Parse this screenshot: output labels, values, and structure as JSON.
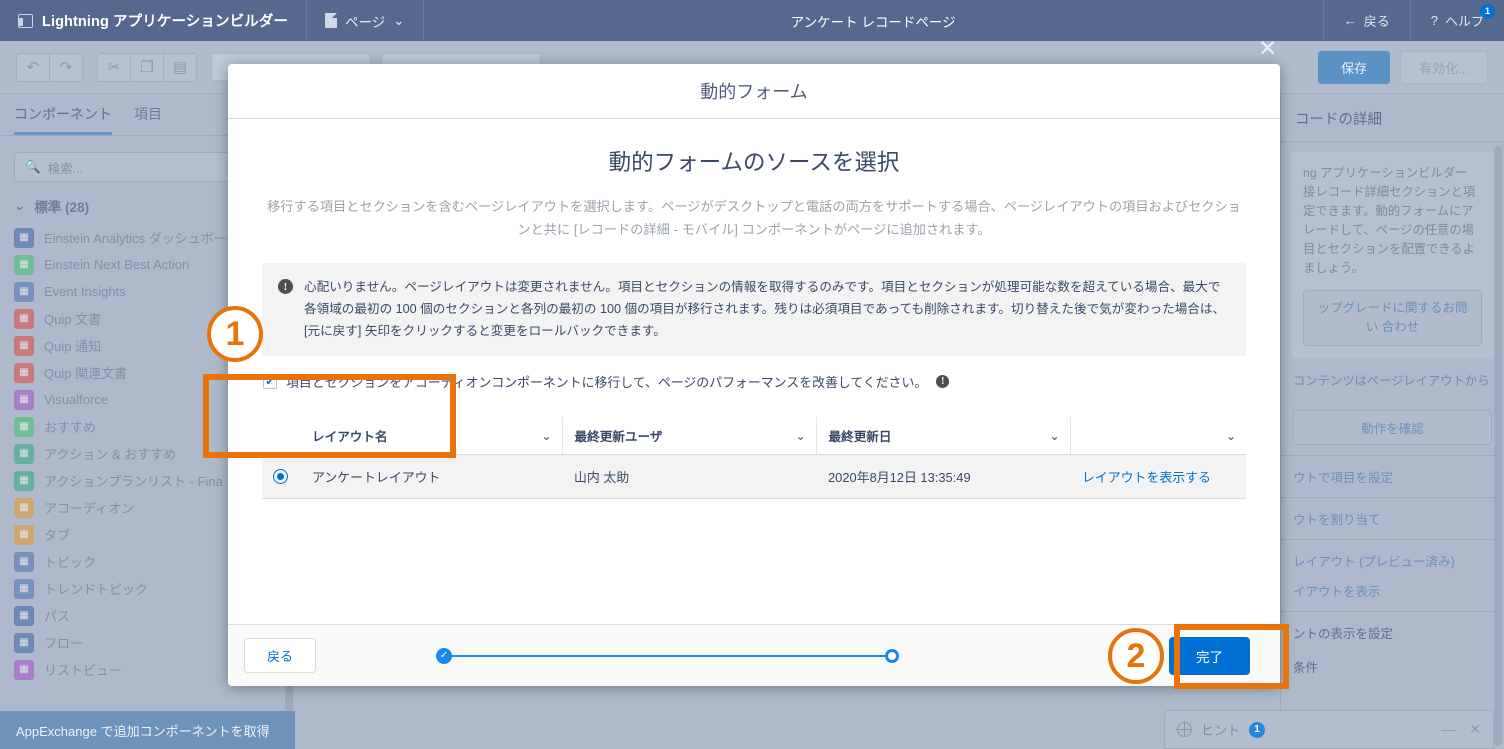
{
  "topbar": {
    "brand": "Lightning アプリケーションビルダー",
    "page_menu": "ページ",
    "title": "アンケート レコードページ",
    "back": "戻る",
    "help": "ヘルプ",
    "help_badge": "1"
  },
  "toolbar": {
    "undo_icon": "undo-icon",
    "redo_icon": "redo-icon",
    "cut_icon": "cut-icon",
    "copy_icon": "copy-icon",
    "paste_icon": "paste-icon",
    "save_label": "保存",
    "activate_label": "有効化..."
  },
  "left_panel": {
    "tabs": [
      {
        "label": "コンポーネント",
        "active": true
      },
      {
        "label": "項目",
        "active": false
      }
    ],
    "search_placeholder": "検索...",
    "section_label": "標準 (28)",
    "items": [
      {
        "label": "Einstein Analytics ダッシュボー",
        "color": "#4a6fa8"
      },
      {
        "label": "Einstein Next Best Action",
        "color": "#4bc076"
      },
      {
        "label": "Event Insights",
        "color": "#5a79b5"
      },
      {
        "label": "Quip 文書",
        "color": "#d9534f"
      },
      {
        "label": "Quip 通知",
        "color": "#d9534f"
      },
      {
        "label": "Quip 関連文書",
        "color": "#d9534f"
      },
      {
        "label": "Visualforce",
        "color": "#a65cc9"
      },
      {
        "label": "おすすめ",
        "color": "#4bc076"
      },
      {
        "label": "アクション & おすすめ",
        "color": "#3fa98a"
      },
      {
        "label": "アクションプランリスト - Fina",
        "color": "#3fa98a"
      },
      {
        "label": "アコーディオン",
        "color": "#e09a3c"
      },
      {
        "label": "タブ",
        "color": "#e09a3c"
      },
      {
        "label": "トピック",
        "color": "#5a79b5"
      },
      {
        "label": "トレンドトピック",
        "color": "#5a79b5"
      },
      {
        "label": "パス",
        "color": "#4a6fa8"
      },
      {
        "label": "フロー",
        "color": "#4a6fa8"
      },
      {
        "label": "リストビュー",
        "color": "#a65cc9"
      }
    ],
    "appexchange": "AppExchange で追加コンポーネントを取得"
  },
  "right_panel": {
    "title": "コードの詳細",
    "promo_text": "ng アプリケーションビルダー 接レコード詳細セクションと項 定できます。動的フォームにア レードして、ページの任意の場 目とセクションを配置できるよ ましょう。",
    "promo_button": "ップグレードに関するお問い 合わせ",
    "note": "コンテンツはページレイアウトから",
    "check_button": "動作を確認",
    "actions": [
      "ウトで項目を設定",
      "ウトを割り当て",
      "レイアウト (プレビュー済み)",
      "イアウトを表示",
      "ントの表示を設定",
      "条件"
    ],
    "hint_label": "ヒント",
    "hint_badge": "1",
    "minimize_icon": "minimize-icon",
    "close_icon": "close-icon"
  },
  "modal": {
    "close_icon": "close-icon",
    "header_title": "動的フォーム",
    "heading": "動的フォームのソースを選択",
    "description": "移行する項目とセクションを含むページレイアウトを選択します。ページがデスクトップと電話の両方をサポートする場合、ページレイアウトの項目およびセクションと共に [レコードの詳細 - モバイル] コンポーネントがページに追加されます。",
    "info_icon": "info-icon",
    "info_text": "心配いりません。ページレイアウトは変更されません。項目とセクションの情報を取得するのみです。項目とセクションが処理可能な数を超えている場合、最大で各領域の最初の 100 個のセクションと各列の最初の 100 個の項目が移行されます。残りは必須項目であっても削除されます。切り替えた後で気が変わった場合は、[元に戻す] 矢印をクリックすると変更をロールバックできます。",
    "checkbox_checked": true,
    "checkbox_label": "項目とセクションをアコーディオンコンポーネントに移行して、ページのパフォーマンスを改善してください。",
    "table": {
      "columns": [
        "レイアウト名",
        "最終更新ユーザ",
        "最終更新日",
        ""
      ],
      "rows": [
        {
          "selected": true,
          "name": "アンケートレイアウト",
          "user": "山内 太助",
          "date": "2020年8月12日 13:35:49",
          "action": "レイアウトを表示する"
        }
      ]
    },
    "footer": {
      "back_label": "戻る",
      "done_label": "完了",
      "progress_step_done": "step-complete",
      "progress_step_current": "step-current"
    }
  },
  "annotations": [
    {
      "number": "①",
      "text": "1"
    },
    {
      "number": "②",
      "text": "2"
    }
  ]
}
